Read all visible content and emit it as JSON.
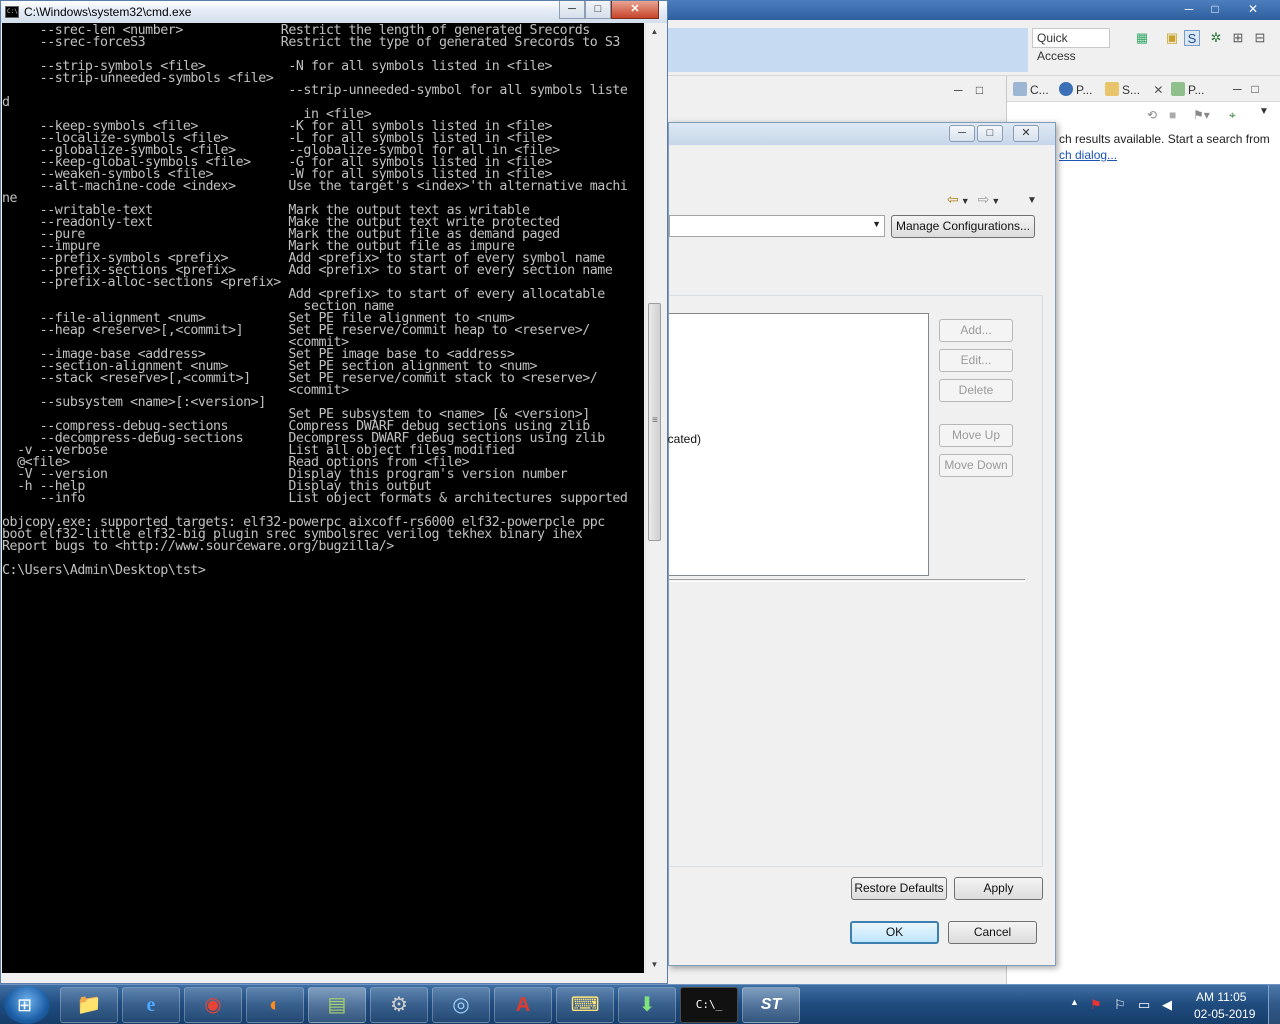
{
  "cmd": {
    "title": "C:\\Windows\\system32\\cmd.exe",
    "icon_text": "C:\\",
    "controls": {
      "minimize": "─",
      "maximize": "□",
      "close": "✕"
    },
    "console_lines": [
      "     --srec-len <number>             Restrict the length of generated Srecords",
      "     --srec-forceS3                  Restrict the type of generated Srecords to S3",
      "",
      "     --strip-symbols <file>           -N for all symbols listed in <file>",
      "     --strip-unneeded-symbols <file>",
      "                                      --strip-unneeded-symbol for all symbols liste",
      "d",
      "                                        in <file>",
      "     --keep-symbols <file>            -K for all symbols listed in <file>",
      "     --localize-symbols <file>        -L for all symbols listed in <file>",
      "     --globalize-symbols <file>       --globalize-symbol for all in <file>",
      "     --keep-global-symbols <file>     -G for all symbols listed in <file>",
      "     --weaken-symbols <file>          -W for all symbols listed in <file>",
      "     --alt-machine-code <index>       Use the target's <index>'th alternative machi",
      "ne",
      "     --writable-text                  Mark the output text as writable",
      "     --readonly-text                  Make the output text write protected",
      "     --pure                           Mark the output file as demand paged",
      "     --impure                         Mark the output file as impure",
      "     --prefix-symbols <prefix>        Add <prefix> to start of every symbol name",
      "     --prefix-sections <prefix>       Add <prefix> to start of every section name",
      "     --prefix-alloc-sections <prefix>",
      "                                      Add <prefix> to start of every allocatable",
      "                                        section name",
      "     --file-alignment <num>           Set PE file alignment to <num>",
      "     --heap <reserve>[,<commit>]      Set PE reserve/commit heap to <reserve>/",
      "                                      <commit>",
      "     --image-base <address>           Set PE image base to <address>",
      "     --section-alignment <num>        Set PE section alignment to <num>",
      "     --stack <reserve>[,<commit>]     Set PE reserve/commit stack to <reserve>/",
      "                                      <commit>",
      "     --subsystem <name>[:<version>]",
      "                                      Set PE subsystem to <name> [& <version>]",
      "     --compress-debug-sections        Compress DWARF debug sections using zlib",
      "     --decompress-debug-sections      Decompress DWARF debug sections using zlib",
      "  -v --verbose                        List all object files modified",
      "  @<file>                             Read options from <file>",
      "  -V --version                        Display this program's version number",
      "  -h --help                           Display this output",
      "     --info                           List object formats & architectures supported",
      "",
      "objcopy.exe: supported targets: elf32-powerpc aixcoff-rs6000 elf32-powerpcle ppc",
      "boot elf32-little elf32-big plugin srec symbolsrec verilog tekhex binary ihex",
      "Report bugs to <http://www.sourceware.org/bugzilla/>",
      "",
      "C:\\Users\\Admin\\Desktop\\tst>"
    ]
  },
  "eclipse": {
    "quick_access": "Quick Access",
    "window_controls": {
      "minimize": "─",
      "maximize": "□",
      "close": "✕"
    },
    "tabs": [
      {
        "label": "C...",
        "icon": "console-icon"
      },
      {
        "label": "P...",
        "icon": "properties-icon"
      },
      {
        "label": "S...",
        "icon": "search-icon",
        "active": true
      },
      {
        "label": "P...",
        "icon": "progress-icon"
      }
    ],
    "search_message": "ch results available. Start a search from",
    "search_link": "ch dialog..."
  },
  "dialog": {
    "controls": {
      "minimize": "─",
      "maximize": "□",
      "close": "✕"
    },
    "manage_configurations": "Manage Configurations...",
    "side_buttons": {
      "add": "Add...",
      "edit": "Edit...",
      "delete": "Delete",
      "move_up": "Move Up",
      "move_down": "Move Down"
    },
    "list_items": [
      "ecated)"
    ],
    "restore_defaults": "Restore Defaults",
    "apply": "Apply",
    "ok": "OK",
    "cancel": "Cancel"
  },
  "taskbar": {
    "apps": [
      {
        "name": "file-explorer",
        "glyph": "📁"
      },
      {
        "name": "internet-explorer",
        "glyph": "e"
      },
      {
        "name": "chrome",
        "glyph": "◉"
      },
      {
        "name": "firefox",
        "glyph": "◐"
      },
      {
        "name": "task-manager",
        "glyph": "▤"
      },
      {
        "name": "tool",
        "glyph": "⚙"
      },
      {
        "name": "network",
        "glyph": "◎"
      },
      {
        "name": "acrobat",
        "glyph": "A"
      },
      {
        "name": "remote-desktop",
        "glyph": "⌨"
      },
      {
        "name": "install",
        "glyph": "⬇"
      },
      {
        "name": "cmd",
        "glyph": "C:\\_"
      },
      {
        "name": "st",
        "glyph": "ST"
      }
    ],
    "clock_time": "AM 11:05",
    "clock_date": "02-05-2019"
  }
}
